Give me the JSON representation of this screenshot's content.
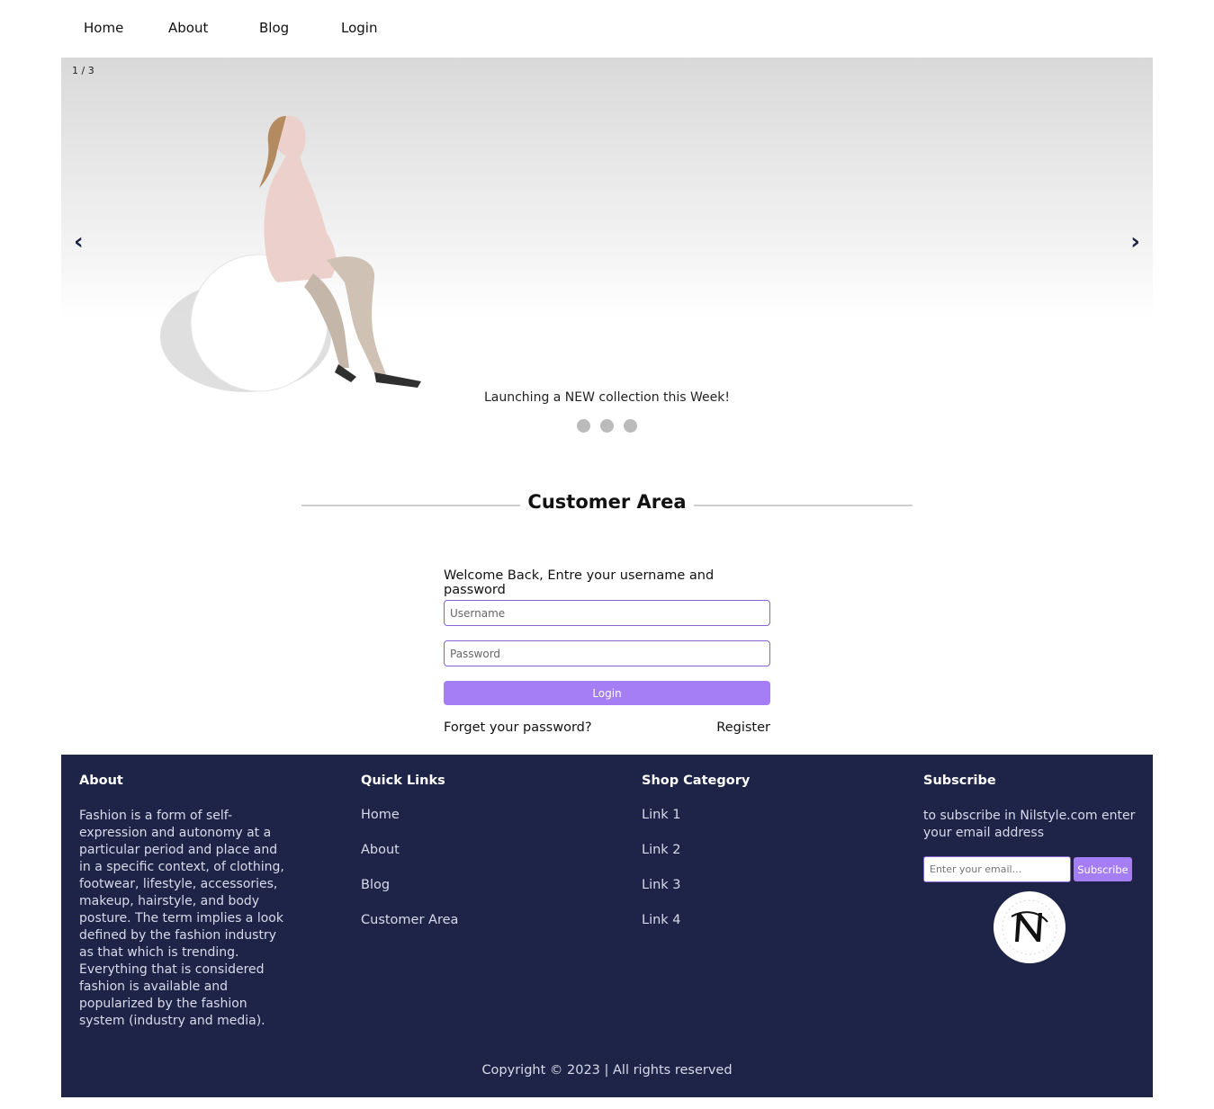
{
  "nav": {
    "items": [
      {
        "label": "Home"
      },
      {
        "label": "About"
      },
      {
        "label": "Blog"
      },
      {
        "label": "Login"
      }
    ]
  },
  "slider": {
    "counter": "1 / 3",
    "prev_icon": "‹",
    "next_icon": "›",
    "caption": "Launching a NEW collection this Week!",
    "dot_count": 3
  },
  "customer_area": {
    "title": "Customer Area",
    "welcome": "Welcome Back, Entre your username and password",
    "username_placeholder": "Username",
    "password_placeholder": "Password",
    "login_label": "Login",
    "forgot_label": "Forget your password?",
    "register_label": "Register"
  },
  "footer": {
    "about": {
      "title": "About",
      "text": "Fashion is a form of self-expression and autonomy at a particular period and place and in a specific context, of clothing, footwear, lifestyle, accessories, makeup, hairstyle, and body posture. The term implies a look defined by the fashion industry as that which is trending. Everything that is considered fashion is available and popularized by the fashion system (industry and media)."
    },
    "quick_links": {
      "title": "Quick Links",
      "items": [
        "Home",
        "About",
        "Blog",
        "Customer Area"
      ]
    },
    "shop_category": {
      "title": "Shop Category",
      "items": [
        "Link 1",
        "Link 2",
        "Link 3",
        "Link 4"
      ]
    },
    "subscribe": {
      "title": "Subscribe",
      "text": "to subscribe in Nilstyle.com enter your email address",
      "email_placeholder": "Enter your email...",
      "button_label": "Subscribe",
      "logo_text": "N Style"
    },
    "copyright": "Copyright © 2023 | All rights reserved"
  },
  "colors": {
    "footer_bg": "#1d2447",
    "accent": "#a57df5",
    "input_border": "#8a63d2"
  }
}
